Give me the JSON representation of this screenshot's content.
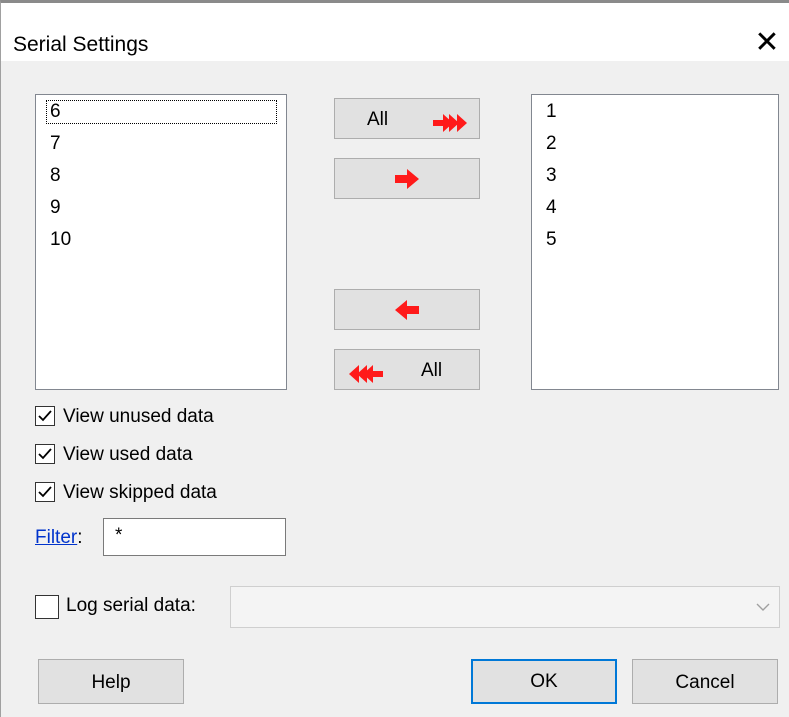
{
  "window": {
    "title": "Serial Settings",
    "close_glyph": "✕"
  },
  "available_list": {
    "items": [
      "6",
      "7",
      "8",
      "9",
      "10"
    ],
    "focused_index": 0
  },
  "selected_list": {
    "items": [
      "1",
      "2",
      "3",
      "4",
      "5"
    ]
  },
  "move_buttons": {
    "add_all_label": "All",
    "add_all_icon": "double-right-arrow-icon",
    "add_one_icon": "right-arrow-icon",
    "remove_one_icon": "left-arrow-icon",
    "remove_all_label": "All",
    "remove_all_icon": "double-left-arrow-icon",
    "arrow_color": "#ff1a1a"
  },
  "options": {
    "view_unused": {
      "label": "View unused data",
      "checked": true
    },
    "view_used": {
      "label": "View used data",
      "checked": true
    },
    "view_skipped": {
      "label": "View skipped data",
      "checked": true
    }
  },
  "filter": {
    "link_label": "Filter",
    "colon": ":",
    "value": "*"
  },
  "log": {
    "label": "Log serial data:",
    "checked": false,
    "path_value": ""
  },
  "footer": {
    "help_label": "Help",
    "ok_label": "OK",
    "cancel_label": "Cancel"
  },
  "colors": {
    "accent": "#0078d7",
    "link": "#0033cc",
    "dialog_bg": "#f0f0f0"
  }
}
